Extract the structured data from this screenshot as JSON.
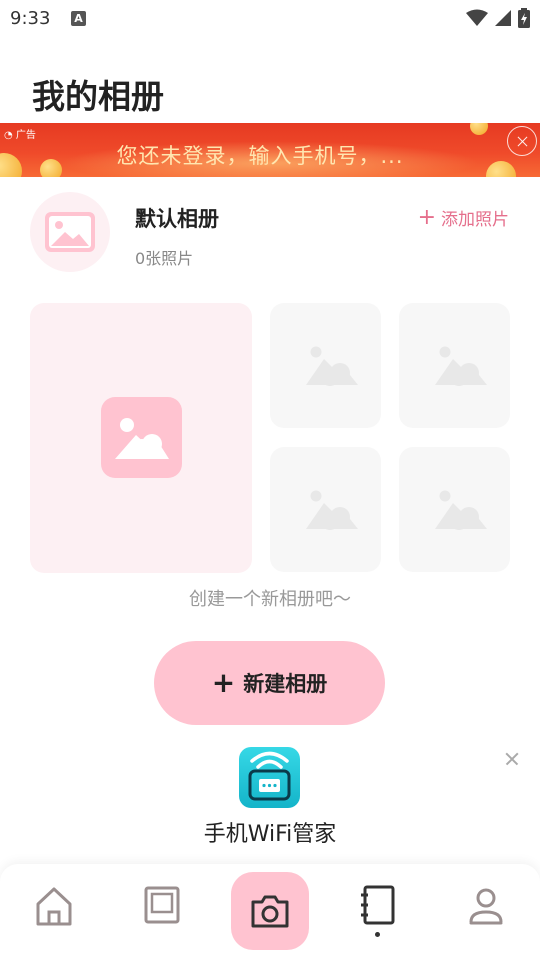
{
  "status_bar": {
    "time": "9:33",
    "notification_glyph": "A"
  },
  "page": {
    "title": "我的相册"
  },
  "ad": {
    "tag": "广告",
    "text": "您还未登录，输入手机号，..."
  },
  "album": {
    "name": "默认相册",
    "count": "0张照片",
    "add_label": "添加照片"
  },
  "empty_hint": "创建一个新相册吧～",
  "new_album_label": "新建相册",
  "promo": {
    "name": "手机WiFi管家"
  },
  "bottom_nav": {
    "items": [
      "home-icon",
      "album-icon",
      "camera-icon",
      "notebook-icon",
      "profile-icon"
    ],
    "active": "notebook-icon"
  },
  "colors": {
    "accent_pink": "#ffc3d0",
    "link_pink": "#e56f8c",
    "ad_red": "#e63a22"
  }
}
